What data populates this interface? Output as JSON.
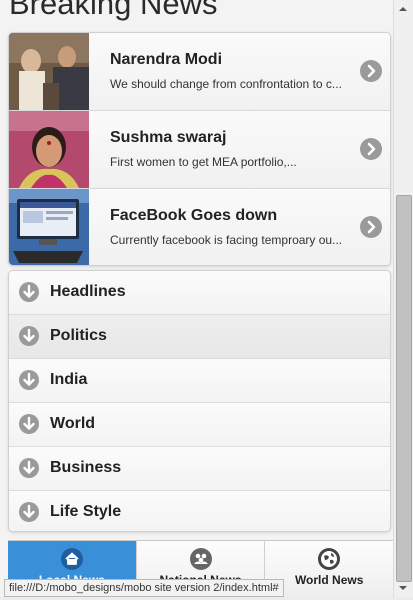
{
  "page": {
    "title": "Breaking News"
  },
  "news": [
    {
      "title": "Narendra Modi",
      "desc": "We should change from confrontation to c..."
    },
    {
      "title": "Sushma swaraj",
      "desc": "First women to get MEA portfolio,..."
    },
    {
      "title": "FaceBook Goes down",
      "desc": "Currently facebook is facing temproary ou..."
    }
  ],
  "categories": [
    {
      "label": "Headlines"
    },
    {
      "label": "Politics"
    },
    {
      "label": "India"
    },
    {
      "label": "World"
    },
    {
      "label": "Business"
    },
    {
      "label": "Life Style"
    }
  ],
  "nav": [
    {
      "label": "Local News",
      "icon": "home-icon",
      "active": true
    },
    {
      "label": "National News",
      "icon": "people-icon",
      "active": false
    },
    {
      "label": "World News",
      "icon": "globe-icon",
      "active": false
    }
  ],
  "status_bar": {
    "url": "file:///D:/mobo_designs/mobo site version 2/index.html#"
  },
  "colors": {
    "active_tab": "#3a8fd9",
    "icon_gray": "#9a9a9a"
  }
}
